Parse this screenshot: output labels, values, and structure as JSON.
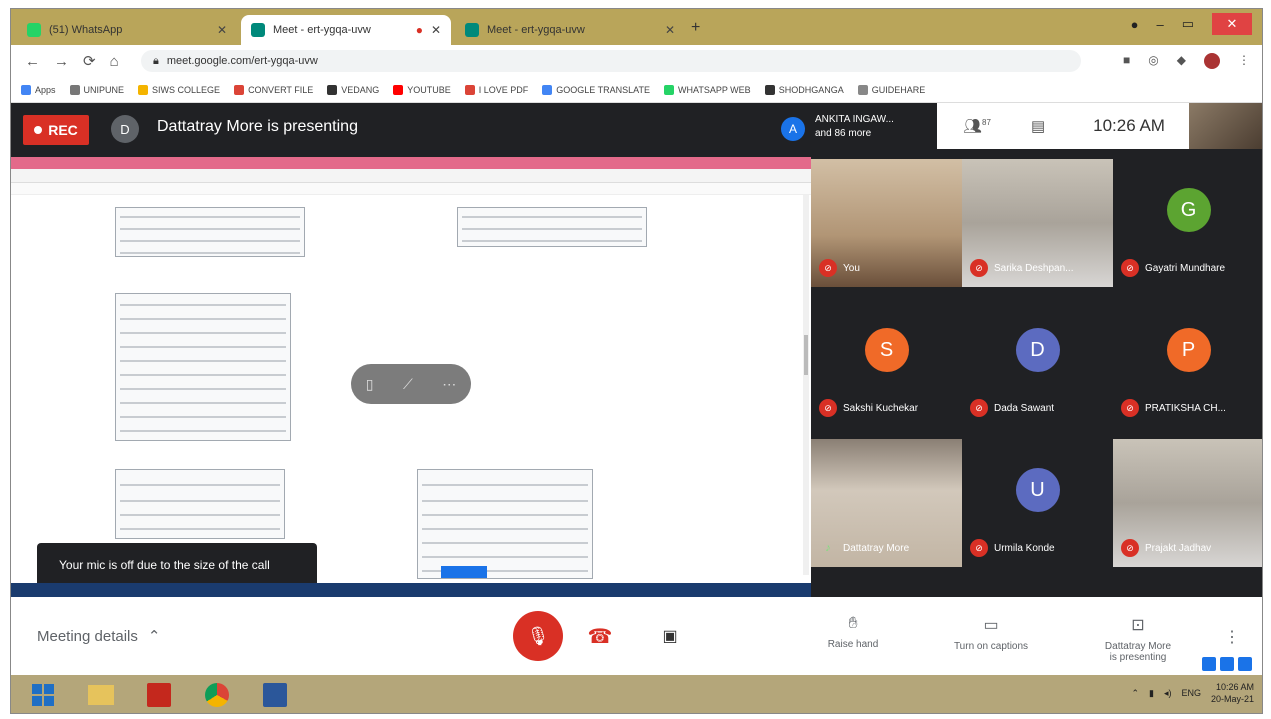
{
  "browser": {
    "tabs": [
      {
        "title": "(51) WhatsApp",
        "icon_color": "#25d366",
        "active": false
      },
      {
        "title": "Meet - ert-ygqa-uvw",
        "icon_color": "#00897b",
        "active": true
      },
      {
        "title": "Meet - ert-ygqa-uvw",
        "icon_color": "#00897b",
        "active": false
      }
    ],
    "url": "meet.google.com/ert-ygqa-uvw",
    "bookmarks": [
      {
        "label": "Apps",
        "color": "#4285f4"
      },
      {
        "label": "UNIPUNE",
        "color": "#777"
      },
      {
        "label": "SIWS COLLEGE",
        "color": "#f4b400"
      },
      {
        "label": "CONVERT FILE",
        "color": "#db4437"
      },
      {
        "label": "VEDANG",
        "color": "#333"
      },
      {
        "label": "YOUTUBE",
        "color": "#ff0000"
      },
      {
        "label": "I LOVE PDF",
        "color": "#db4437"
      },
      {
        "label": "GOOGLE TRANSLATE",
        "color": "#4285f4"
      },
      {
        "label": "WHATSAPP WEB",
        "color": "#25d366"
      },
      {
        "label": "SHODHGANGA",
        "color": "#333"
      },
      {
        "label": "GUIDEHARE",
        "color": "#888"
      }
    ]
  },
  "meet": {
    "rec_label": "REC",
    "presenter_initial": "D",
    "presenting_text": "Dattatray More is presenting",
    "others_initial": "A",
    "others_text_line1": "ANKITA INGAW...",
    "others_text_line2": "and 86 more",
    "people_count": "87",
    "time": "10:26 AM",
    "toast": "Your mic is off due to the size of the call",
    "participants": [
      {
        "name": "You",
        "initial": "",
        "color": "",
        "photo": "photo1",
        "muted": true
      },
      {
        "name": "Sarika Deshpan...",
        "initial": "",
        "color": "",
        "photo": "photo2",
        "muted": true
      },
      {
        "name": "Gayatri Mundhare",
        "initial": "G",
        "color": "#5ca431",
        "photo": "",
        "muted": true
      },
      {
        "name": "Sakshi Kuchekar",
        "initial": "S",
        "color": "#f06a28",
        "photo": "",
        "muted": true
      },
      {
        "name": "Dada Sawant",
        "initial": "D",
        "color": "#5c6bc0",
        "photo": "",
        "muted": true
      },
      {
        "name": "PRATIKSHA CH...",
        "initial": "P",
        "color": "#f06a28",
        "photo": "",
        "muted": true
      },
      {
        "name": "Dattatray More",
        "initial": "",
        "color": "",
        "photo": "photo3",
        "muted": false
      },
      {
        "name": "Urmila Konde",
        "initial": "U",
        "color": "#5c6bc0",
        "photo": "",
        "muted": true
      },
      {
        "name": "Prajakt Jadhav",
        "initial": "",
        "color": "",
        "photo": "photo2",
        "muted": true
      }
    ],
    "bottom": {
      "meeting_details": "Meeting details",
      "raise_hand": "Raise hand",
      "captions": "Turn on captions",
      "presenting_line1": "Dattatray More",
      "presenting_line2": "is presenting"
    }
  },
  "taskbar": {
    "time": "10:26 AM",
    "date": "20-May-21",
    "lang": "ENG"
  }
}
